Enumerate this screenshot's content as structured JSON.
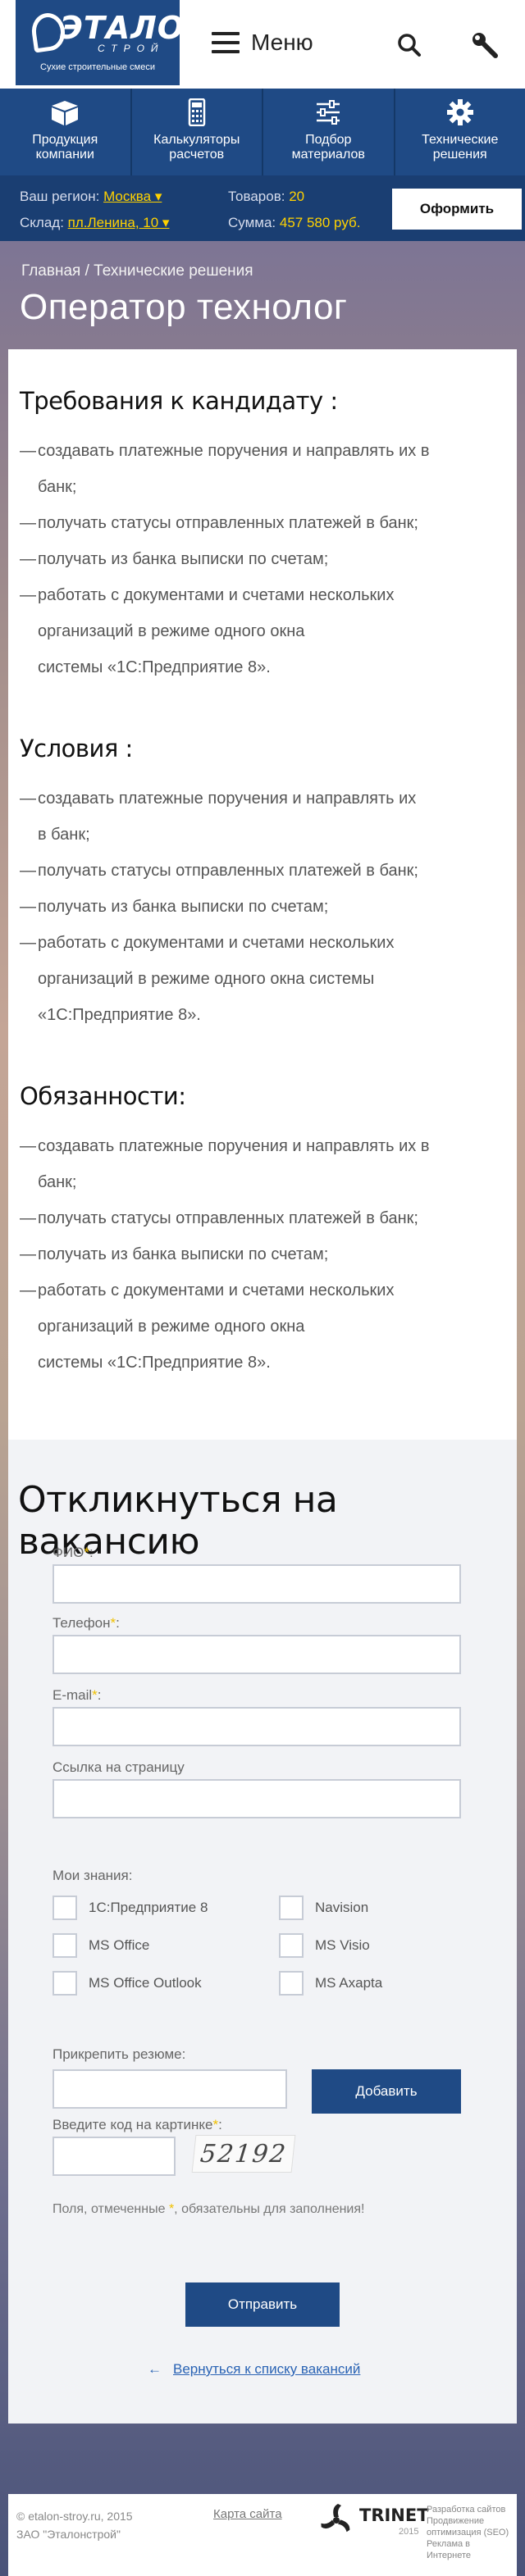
{
  "header": {
    "logo_title": "ЭТАЛОН",
    "logo_sub": "СТРОЙ",
    "logo_tag": "Сухие строительные смеси",
    "menu_label": "Меню"
  },
  "nav": {
    "items": [
      {
        "label_1": "Продукция",
        "label_2": "компании",
        "icon": "box-icon"
      },
      {
        "label_1": "Калькуляторы",
        "label_2": "расчетов",
        "icon": "calculator-icon"
      },
      {
        "label_1": "Подбор",
        "label_2": "материалов",
        "icon": "sliders-icon"
      },
      {
        "label_1": "Технические",
        "label_2": "решения",
        "icon": "gear-icon"
      }
    ]
  },
  "info": {
    "region_label": "Ваш регион:",
    "region_value": "Москва ▾",
    "stock_label": "Склад:",
    "stock_value": "пл.Ленина, 10 ▾",
    "goods_label": "Товаров:",
    "goods_value": "20",
    "sum_label": "Сумма:",
    "sum_value": "457 580 руб.",
    "order_button": "Оформить"
  },
  "breadcrumb": {
    "home": "Главная",
    "sep": " / ",
    "current": "Технические решения"
  },
  "page_title": "Оператор технолог",
  "sections": [
    {
      "title": "Требования к кандидату :",
      "items": [
        [
          "создавать платежные поручения и направлять их в",
          "банк;"
        ],
        [
          "получать статусы отправленных платежей в банк;"
        ],
        [
          "получать из банка выписки по счетам;"
        ],
        [
          "работать с документами и счетами нескольких",
          "организаций в режиме одного окна",
          "системы «1С:Предприятие 8»."
        ]
      ]
    },
    {
      "title": "Условия :",
      "items": [
        [
          "создавать платежные поручения и направлять их",
          "в банк;"
        ],
        [
          "получать статусы отправленных платежей в банк;"
        ],
        [
          "получать из банка выписки по счетам;"
        ],
        [
          "работать с документами и счетами нескольких",
          "организаций в режиме одного окна  системы",
          "«1С:Предприятие 8»."
        ]
      ]
    },
    {
      "title": "Обязанности:",
      "items": [
        [
          "создавать платежные поручения и направлять их в",
          "банк;"
        ],
        [
          "получать статусы отправленных платежей в банк;"
        ],
        [
          "получать из банка выписки по счетам;"
        ],
        [
          "работать с документами и счетами нескольких",
          "организаций в режиме одного окна",
          "системы «1С:Предприятие 8»."
        ]
      ]
    }
  ],
  "form": {
    "title": "Откликнуться на вакансию",
    "fio_label": "ФИО",
    "phone_label": "Телефон",
    "email_label": "E-mail",
    "link_label": "Ссылка на страницу",
    "req_mark": "*",
    "colon": ":",
    "skills_title": "Мои знания:",
    "skills": [
      "1С:Предприятие 8",
      "Navision",
      "MS Office",
      "MS Visio",
      "MS Office Outlook",
      "MS Axapta"
    ],
    "resume_label": "Прикрепить резюме:",
    "add_button": "Добавить",
    "captcha_label": "Введите код на картинке",
    "captcha_text": "52192",
    "note_before": "Поля, отмеченные ",
    "note_after": ", обязательны для заполнения!",
    "submit_button": "Отправить",
    "back_arrow": "←",
    "back_link": "Вернуться к списку вакансий"
  },
  "footer": {
    "copy_1": "© etalon-stroy.ru, 2015",
    "copy_2": "ЗАО \"Эталонстрой\"",
    "map_link": "Карта сайта",
    "dev_name": "TRINET",
    "dev_year": "2015",
    "dev_1": "Разработка сайтов",
    "dev_2": "Продвижение",
    "dev_3": "оптимизация (SEO)",
    "dev_4": "Реклама в Интернете"
  },
  "colors": {
    "brand": "#1f4a85",
    "accent": "#ffd200",
    "link": "#2a63b4"
  }
}
